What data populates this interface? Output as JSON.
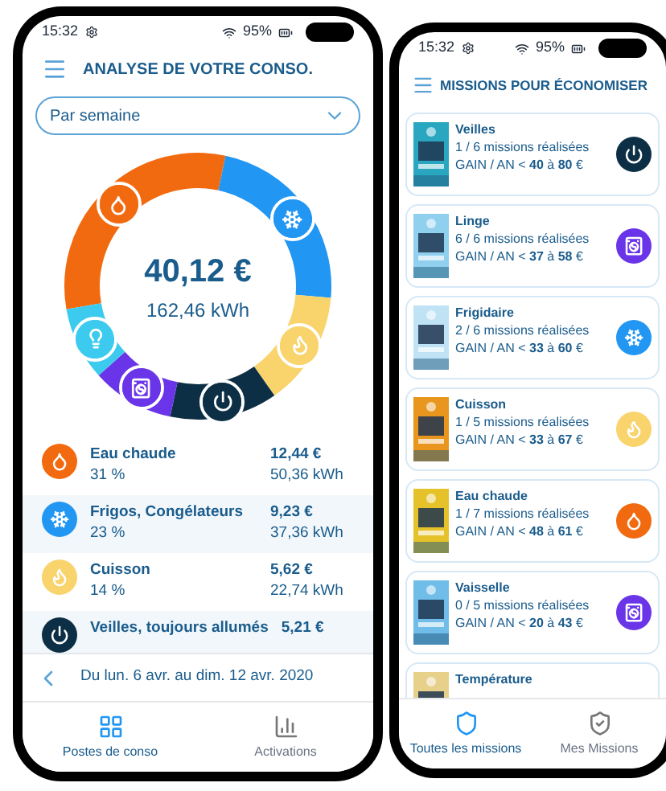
{
  "left_phone": {
    "status_bar": {
      "time": "15:32",
      "battery": "95%"
    },
    "title": "ANALYSE DE VOTRE CONSO.",
    "period_select": {
      "value": "Par semaine"
    },
    "donut": {
      "amount": "40,12 €",
      "energy": "162,46 kWh"
    },
    "categories": [
      {
        "kind": "water",
        "name": "Eau chaude",
        "share": "31 %",
        "amount": "12,44 €",
        "energy": "50,36 kWh"
      },
      {
        "kind": "cold",
        "name": "Frigos, Congélateurs",
        "share": "23 %",
        "amount": "9,23 €",
        "energy": "37,36 kWh"
      },
      {
        "kind": "cooking",
        "name": "Cuisson",
        "share": "14 %",
        "amount": "5,62 €",
        "energy": "22,74 kWh"
      },
      {
        "kind": "standby",
        "name": "Veilles, toujours allumés",
        "amount": "5,21 €"
      }
    ],
    "date_range": "Du lun. 6 avr. au dim. 12 avr. 2020",
    "nav": [
      {
        "label": "Postes de conso",
        "selected": true
      },
      {
        "label": "Activations",
        "selected": false
      }
    ]
  },
  "right_phone": {
    "status_bar": {
      "time": "15:32",
      "battery": "95%"
    },
    "title": "MISSIONS POUR ÉCONOMISER",
    "missions": [
      {
        "kind": "standby",
        "name": "Veilles",
        "progress": "1 / 6 missions réalisées",
        "gain": "GAIN / AN < **40** à **80** €"
      },
      {
        "kind": "laundry",
        "name": "Linge",
        "progress": "6 / 6 missions réalisées",
        "gain": "GAIN / AN < **37** à **58** €"
      },
      {
        "kind": "cold",
        "name": "Frigidaire",
        "progress": "2 / 6 missions réalisées",
        "gain": "GAIN / AN < **33** à **60** €"
      },
      {
        "kind": "cooking",
        "name": "Cuisson",
        "progress": "1 / 5 missions réalisées",
        "gain": "GAIN / AN < **33** à **67** €"
      },
      {
        "kind": "water",
        "name": "Eau chaude",
        "progress": "1 / 7 missions réalisées",
        "gain": "GAIN / AN < **48** à **61** €"
      },
      {
        "kind": "laundry",
        "name": "Vaisselle",
        "progress": "0 / 5 missions réalisées",
        "gain": "GAIN / AN < **20** à **43** €"
      },
      {
        "name": "Température"
      }
    ],
    "nav": [
      {
        "label": "Toutes les missions",
        "selected": true
      },
      {
        "label": "Mes Missions",
        "selected": false
      }
    ]
  }
}
